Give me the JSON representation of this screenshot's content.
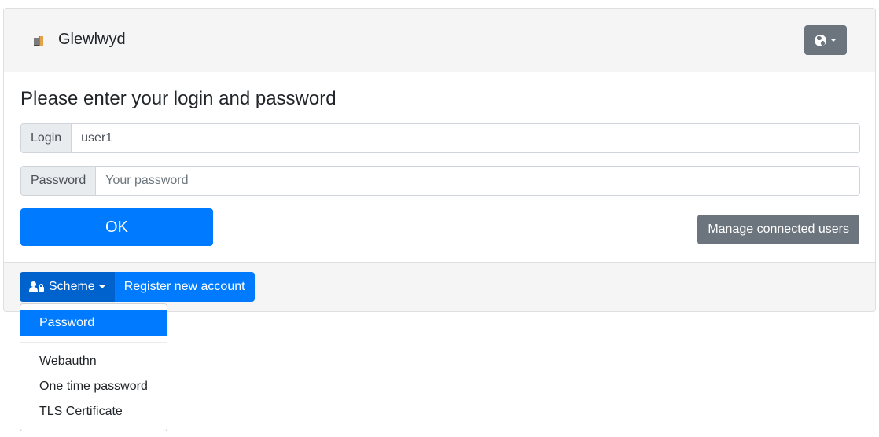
{
  "header": {
    "brand_name": "Glewlwyd",
    "brand_icon": "door-icon",
    "language_button_icon": "globe-icon"
  },
  "form": {
    "title": "Please enter your login and password",
    "login": {
      "label": "Login",
      "value": "user1",
      "placeholder": ""
    },
    "password": {
      "label": "Password",
      "value": "",
      "placeholder": "Your password"
    },
    "ok_label": "OK",
    "manage_label": "Manage connected users"
  },
  "footer": {
    "scheme_label": "Scheme",
    "scheme_icon": "user-lock-icon",
    "register_label": "Register new account"
  },
  "scheme_menu": {
    "selected": "Password",
    "items": [
      {
        "label": "Password",
        "active": true
      },
      {
        "label": "Webauthn",
        "active": false
      },
      {
        "label": "One time password",
        "active": false
      },
      {
        "label": "TLS Certificate",
        "active": false
      }
    ]
  },
  "colors": {
    "primary": "#007bff",
    "primary_dark": "#0062cc",
    "secondary": "#6c757d",
    "header_bg": "#f5f5f5"
  }
}
